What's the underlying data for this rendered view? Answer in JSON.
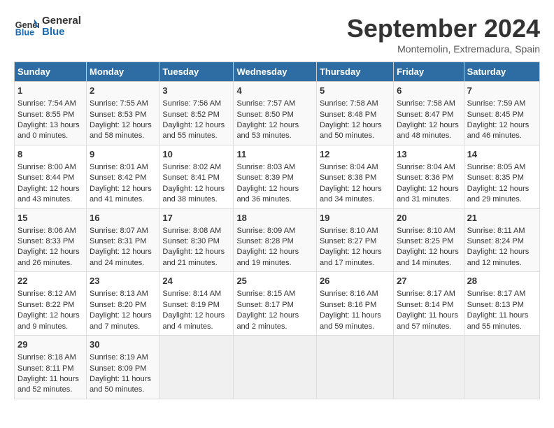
{
  "logo": {
    "line1": "General",
    "line2": "Blue"
  },
  "title": "September 2024",
  "subtitle": "Montemolin, Extremadura, Spain",
  "headers": [
    "Sunday",
    "Monday",
    "Tuesday",
    "Wednesday",
    "Thursday",
    "Friday",
    "Saturday"
  ],
  "rows": [
    [
      {
        "day": "1",
        "sunrise": "Sunrise: 7:54 AM",
        "sunset": "Sunset: 8:55 PM",
        "daylight": "Daylight: 13 hours and 0 minutes."
      },
      {
        "day": "2",
        "sunrise": "Sunrise: 7:55 AM",
        "sunset": "Sunset: 8:53 PM",
        "daylight": "Daylight: 12 hours and 58 minutes."
      },
      {
        "day": "3",
        "sunrise": "Sunrise: 7:56 AM",
        "sunset": "Sunset: 8:52 PM",
        "daylight": "Daylight: 12 hours and 55 minutes."
      },
      {
        "day": "4",
        "sunrise": "Sunrise: 7:57 AM",
        "sunset": "Sunset: 8:50 PM",
        "daylight": "Daylight: 12 hours and 53 minutes."
      },
      {
        "day": "5",
        "sunrise": "Sunrise: 7:58 AM",
        "sunset": "Sunset: 8:48 PM",
        "daylight": "Daylight: 12 hours and 50 minutes."
      },
      {
        "day": "6",
        "sunrise": "Sunrise: 7:58 AM",
        "sunset": "Sunset: 8:47 PM",
        "daylight": "Daylight: 12 hours and 48 minutes."
      },
      {
        "day": "7",
        "sunrise": "Sunrise: 7:59 AM",
        "sunset": "Sunset: 8:45 PM",
        "daylight": "Daylight: 12 hours and 46 minutes."
      }
    ],
    [
      {
        "day": "8",
        "sunrise": "Sunrise: 8:00 AM",
        "sunset": "Sunset: 8:44 PM",
        "daylight": "Daylight: 12 hours and 43 minutes."
      },
      {
        "day": "9",
        "sunrise": "Sunrise: 8:01 AM",
        "sunset": "Sunset: 8:42 PM",
        "daylight": "Daylight: 12 hours and 41 minutes."
      },
      {
        "day": "10",
        "sunrise": "Sunrise: 8:02 AM",
        "sunset": "Sunset: 8:41 PM",
        "daylight": "Daylight: 12 hours and 38 minutes."
      },
      {
        "day": "11",
        "sunrise": "Sunrise: 8:03 AM",
        "sunset": "Sunset: 8:39 PM",
        "daylight": "Daylight: 12 hours and 36 minutes."
      },
      {
        "day": "12",
        "sunrise": "Sunrise: 8:04 AM",
        "sunset": "Sunset: 8:38 PM",
        "daylight": "Daylight: 12 hours and 34 minutes."
      },
      {
        "day": "13",
        "sunrise": "Sunrise: 8:04 AM",
        "sunset": "Sunset: 8:36 PM",
        "daylight": "Daylight: 12 hours and 31 minutes."
      },
      {
        "day": "14",
        "sunrise": "Sunrise: 8:05 AM",
        "sunset": "Sunset: 8:35 PM",
        "daylight": "Daylight: 12 hours and 29 minutes."
      }
    ],
    [
      {
        "day": "15",
        "sunrise": "Sunrise: 8:06 AM",
        "sunset": "Sunset: 8:33 PM",
        "daylight": "Daylight: 12 hours and 26 minutes."
      },
      {
        "day": "16",
        "sunrise": "Sunrise: 8:07 AM",
        "sunset": "Sunset: 8:31 PM",
        "daylight": "Daylight: 12 hours and 24 minutes."
      },
      {
        "day": "17",
        "sunrise": "Sunrise: 8:08 AM",
        "sunset": "Sunset: 8:30 PM",
        "daylight": "Daylight: 12 hours and 21 minutes."
      },
      {
        "day": "18",
        "sunrise": "Sunrise: 8:09 AM",
        "sunset": "Sunset: 8:28 PM",
        "daylight": "Daylight: 12 hours and 19 minutes."
      },
      {
        "day": "19",
        "sunrise": "Sunrise: 8:10 AM",
        "sunset": "Sunset: 8:27 PM",
        "daylight": "Daylight: 12 hours and 17 minutes."
      },
      {
        "day": "20",
        "sunrise": "Sunrise: 8:10 AM",
        "sunset": "Sunset: 8:25 PM",
        "daylight": "Daylight: 12 hours and 14 minutes."
      },
      {
        "day": "21",
        "sunrise": "Sunrise: 8:11 AM",
        "sunset": "Sunset: 8:24 PM",
        "daylight": "Daylight: 12 hours and 12 minutes."
      }
    ],
    [
      {
        "day": "22",
        "sunrise": "Sunrise: 8:12 AM",
        "sunset": "Sunset: 8:22 PM",
        "daylight": "Daylight: 12 hours and 9 minutes."
      },
      {
        "day": "23",
        "sunrise": "Sunrise: 8:13 AM",
        "sunset": "Sunset: 8:20 PM",
        "daylight": "Daylight: 12 hours and 7 minutes."
      },
      {
        "day": "24",
        "sunrise": "Sunrise: 8:14 AM",
        "sunset": "Sunset: 8:19 PM",
        "daylight": "Daylight: 12 hours and 4 minutes."
      },
      {
        "day": "25",
        "sunrise": "Sunrise: 8:15 AM",
        "sunset": "Sunset: 8:17 PM",
        "daylight": "Daylight: 12 hours and 2 minutes."
      },
      {
        "day": "26",
        "sunrise": "Sunrise: 8:16 AM",
        "sunset": "Sunset: 8:16 PM",
        "daylight": "Daylight: 11 hours and 59 minutes."
      },
      {
        "day": "27",
        "sunrise": "Sunrise: 8:17 AM",
        "sunset": "Sunset: 8:14 PM",
        "daylight": "Daylight: 11 hours and 57 minutes."
      },
      {
        "day": "28",
        "sunrise": "Sunrise: 8:17 AM",
        "sunset": "Sunset: 8:13 PM",
        "daylight": "Daylight: 11 hours and 55 minutes."
      }
    ],
    [
      {
        "day": "29",
        "sunrise": "Sunrise: 8:18 AM",
        "sunset": "Sunset: 8:11 PM",
        "daylight": "Daylight: 11 hours and 52 minutes."
      },
      {
        "day": "30",
        "sunrise": "Sunrise: 8:19 AM",
        "sunset": "Sunset: 8:09 PM",
        "daylight": "Daylight: 11 hours and 50 minutes."
      },
      null,
      null,
      null,
      null,
      null
    ]
  ]
}
